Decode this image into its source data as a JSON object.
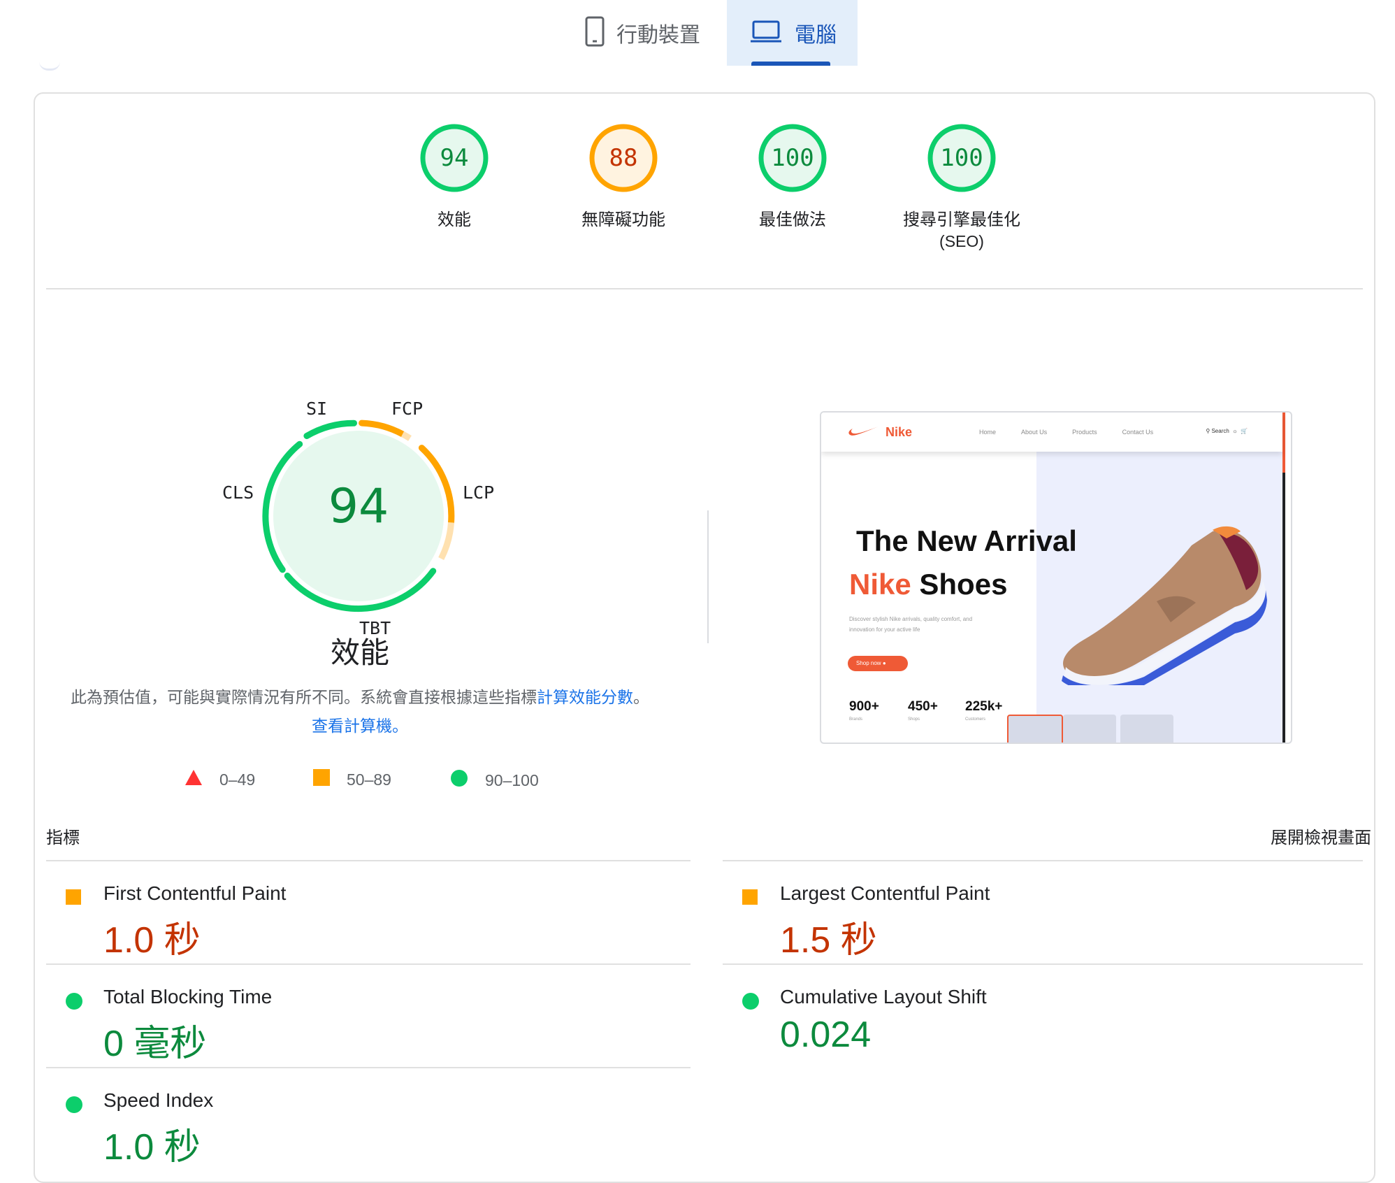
{
  "tabs": {
    "mobile_label": "行動裝置",
    "desktop_label": "電腦",
    "active": "desktop"
  },
  "category_scores": [
    {
      "id": "performance",
      "score": "94",
      "label": "效能",
      "sub": "",
      "status": "pass"
    },
    {
      "id": "accessibility",
      "score": "88",
      "label": "無障礙功能",
      "sub": "",
      "status": "average"
    },
    {
      "id": "best-practices",
      "score": "100",
      "label": "最佳做法",
      "sub": "",
      "status": "pass"
    },
    {
      "id": "seo",
      "score": "100",
      "label": "搜尋引擎最佳化",
      "sub": "(SEO)",
      "status": "pass"
    }
  ],
  "performance": {
    "score": "94",
    "title": "效能",
    "gauge_tags": {
      "si": "SI",
      "fcp": "FCP",
      "lcp": "LCP",
      "tbt": "TBT",
      "cls": "CLS"
    },
    "description_text": "此為預估值，可能與實際情況有所不同。系統會直接根據這些指標",
    "description_link": "計算效能分數",
    "description_separator": "。",
    "calculator_link": "查看計算機。"
  },
  "legend": [
    {
      "shape": "triangle",
      "range": "0–49",
      "color": "#ff3333"
    },
    {
      "shape": "square",
      "range": "50–89",
      "color": "#ffa400"
    },
    {
      "shape": "circle",
      "range": "90–100",
      "color": "#0cce6b"
    }
  ],
  "screenshot": {
    "brand": "Nike",
    "nav": [
      "Home",
      "About Us",
      "Products",
      "Contact Us"
    ],
    "search": "Search",
    "headline_1": "The New Arrival",
    "headline_2a": "Nike",
    "headline_2b": "Shoes",
    "blurb": "Discover stylish Nike arrivals, quality comfort, and innovation for your active life",
    "cta": "Shop now",
    "stats": [
      {
        "value": "900+",
        "label": "Brands"
      },
      {
        "value": "450+",
        "label": "Shops"
      },
      {
        "value": "225k+",
        "label": "Customers"
      }
    ]
  },
  "metrics_section": {
    "title": "指標",
    "expand_label": "展開檢視畫面"
  },
  "metrics": [
    {
      "name": "First Contentful Paint",
      "value": "1.0 秒",
      "status": "average"
    },
    {
      "name": "Largest Contentful Paint",
      "value": "1.5 秒",
      "status": "average"
    },
    {
      "name": "Total Blocking Time",
      "value": "0 毫秒",
      "status": "pass"
    },
    {
      "name": "Cumulative Layout Shift",
      "value": "0.024",
      "status": "pass"
    },
    {
      "name": "Speed Index",
      "value": "1.0 秒",
      "status": "pass"
    }
  ],
  "colors": {
    "pass": "#0cce6b",
    "average": "#ffa400",
    "fail": "#ff3333",
    "link": "#1a73e8",
    "tab_active": "#1a56b8"
  }
}
